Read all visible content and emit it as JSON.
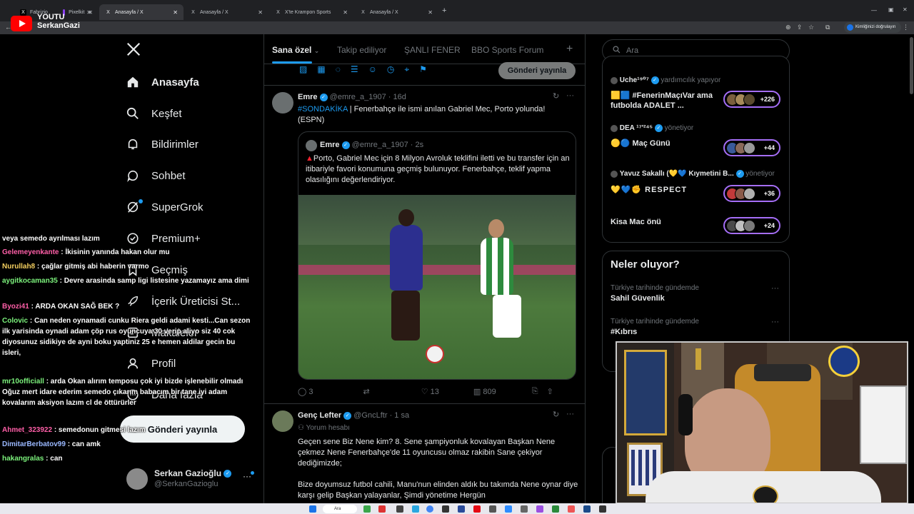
{
  "browser": {
    "tabs": [
      "Fabrizio",
      "Pixelkit",
      "Anasayfa / X",
      "Anasayfa / X",
      "X'te Krampon Sports",
      "Anasayfa / X"
    ],
    "new_tab": "+",
    "verify_label": "Kimliğinizi doğrulayın"
  },
  "overlay": {
    "yt_text_1": "YOUTU",
    "yt_text_2": "SerkanGazi"
  },
  "nav": {
    "items": [
      "Anasayfa",
      "Keşfet",
      "Bildirimler",
      "Sohbet",
      "SuperGrok",
      "Premium+",
      "Geçmiş",
      "İçerik Üreticisi St...",
      "Makaleler",
      "Profil",
      "Daha fazla"
    ],
    "post_button": "Gönderi yayınla",
    "account_name": "Serkan Gazioğlu",
    "account_handle": "@SerkanGazioglu"
  },
  "chat": [
    {
      "user": "",
      "text": "veya semedo ayrılması lazım"
    },
    {
      "user": "Gelemeyenkante",
      "text": ": İkisinin yanında hakan olur mu"
    },
    {
      "user": "Nurullah8",
      "text": ": çağlar gitmiş abi haberin varmo"
    },
    {
      "user": "aygitkocaman35",
      "text": ": Devre arasinda samp ligi listesine yazamayız ama dimi"
    },
    {
      "user": "Byozi41",
      "text": ": ARDA OKAN SAĞ BEK ?"
    },
    {
      "user": "Colovic",
      "text": ": Can neden oynamadi cunku Riera geldi adami kesti...Can sezon ilk yarisinda oynadi adam çöp rus oyuncuya 30 verip aliyo siz 40 cok diyosunuz sidikiye de ayni boku yaptiniz 25 e hemen aldilar gecin bu isleri,"
    },
    {
      "user": "mr10officiall",
      "text": ": arda Okan alırım temposu çok iyi bizde işlenebilir olmadı Oğuz mert idare ederim semedo çıkarım babacım bir tane iyi adam kovalarım aksiyon lazım cl de öttürürler"
    },
    {
      "user": "Ahmet_323922",
      "text": ": semedonun gitmesi lazım"
    },
    {
      "user": "DimitarBerbatov99",
      "text": ": can amk"
    },
    {
      "user": "hakangralas",
      "text": ": can"
    }
  ],
  "center": {
    "tabs": [
      "Sana özel",
      "Takip ediliyor",
      "ŞANLI FENER",
      "BBO Sports Forum"
    ],
    "add_tab": "+",
    "composer_post": "Gönderi yayınla",
    "tweet1": {
      "name": "Emre",
      "handle": "@emre_a_1907",
      "time": "· 16d",
      "hashtag": "#SONDAKİKA",
      "text": " | Fenerbahçe ile ismi anılan Gabriel Mec, Porto yolunda! (ESPN)",
      "quote": {
        "name": "Emre",
        "handle": "@emre_a_1907",
        "time": "· 2s",
        "text": "Porto, Gabriel Mec için 8 Milyon Avroluk teklifini iletti ve bu transfer için an itibariyle favori konumuna geçmiş bulunuyor. Fenerbahçe, teklif yapma olasılığını değerlendiriyor."
      },
      "replies": "3",
      "likes": "13",
      "views": "809"
    },
    "tweet2": {
      "name": "Genç Lefter",
      "handle": "@GncLftr",
      "time": "· 1 sa",
      "tag": "Yorum hesabı",
      "p1": "Geçen sene Biz Nene kim? 8. Sene şampiyonluk kovalayan Başkan Nene çekmez Nene Fenerbahçe'de 11 oyuncusu olmaz rakibin Sane çekiyor dediğimizde;",
      "p2": "Bize doyumsuz futbol cahili, Manu'nun elinden aldık bu takımda Nene oynar diye karşı gelip Başkan yalayanlar, Şimdi yönetime Hergün"
    }
  },
  "right": {
    "search_placeholder": "Ara",
    "spaces": [
      {
        "host": "Uche¹⁹⁰⁷",
        "role": "yardımcılık yapıyor",
        "title": "🟨🟦 #FenerinMaçıVar ama futbolda ADALET ...",
        "count": "+226"
      },
      {
        "host": "DEA ¹⁷ʹ²⁴⁵",
        "role": "yönetiyor",
        "title": "🟡🔵 Maç Günü",
        "count": "+44"
      },
      {
        "host": "Yavuz Sakallı (💛💙 Kıymetini B...",
        "role": "yönetiyor",
        "title": "💛💙✊ RESPECT",
        "count": "+36"
      },
      {
        "host": "",
        "role": "",
        "title": "Kisa Mac önü",
        "count": "+24"
      }
    ],
    "trends_title": "Neler oluyor?",
    "trends": [
      {
        "context": "Türkiye tarihinde gündemde",
        "name": "Sahil Güvenlik"
      },
      {
        "context": "Türkiye tarihinde gündemde",
        "name": "#Kıbrıs"
      }
    ]
  },
  "taskbar": {
    "search": "Ara"
  },
  "colors": {
    "accent": "#1d9bf0",
    "space_ring": "#a56ef7",
    "background": "#000000"
  }
}
